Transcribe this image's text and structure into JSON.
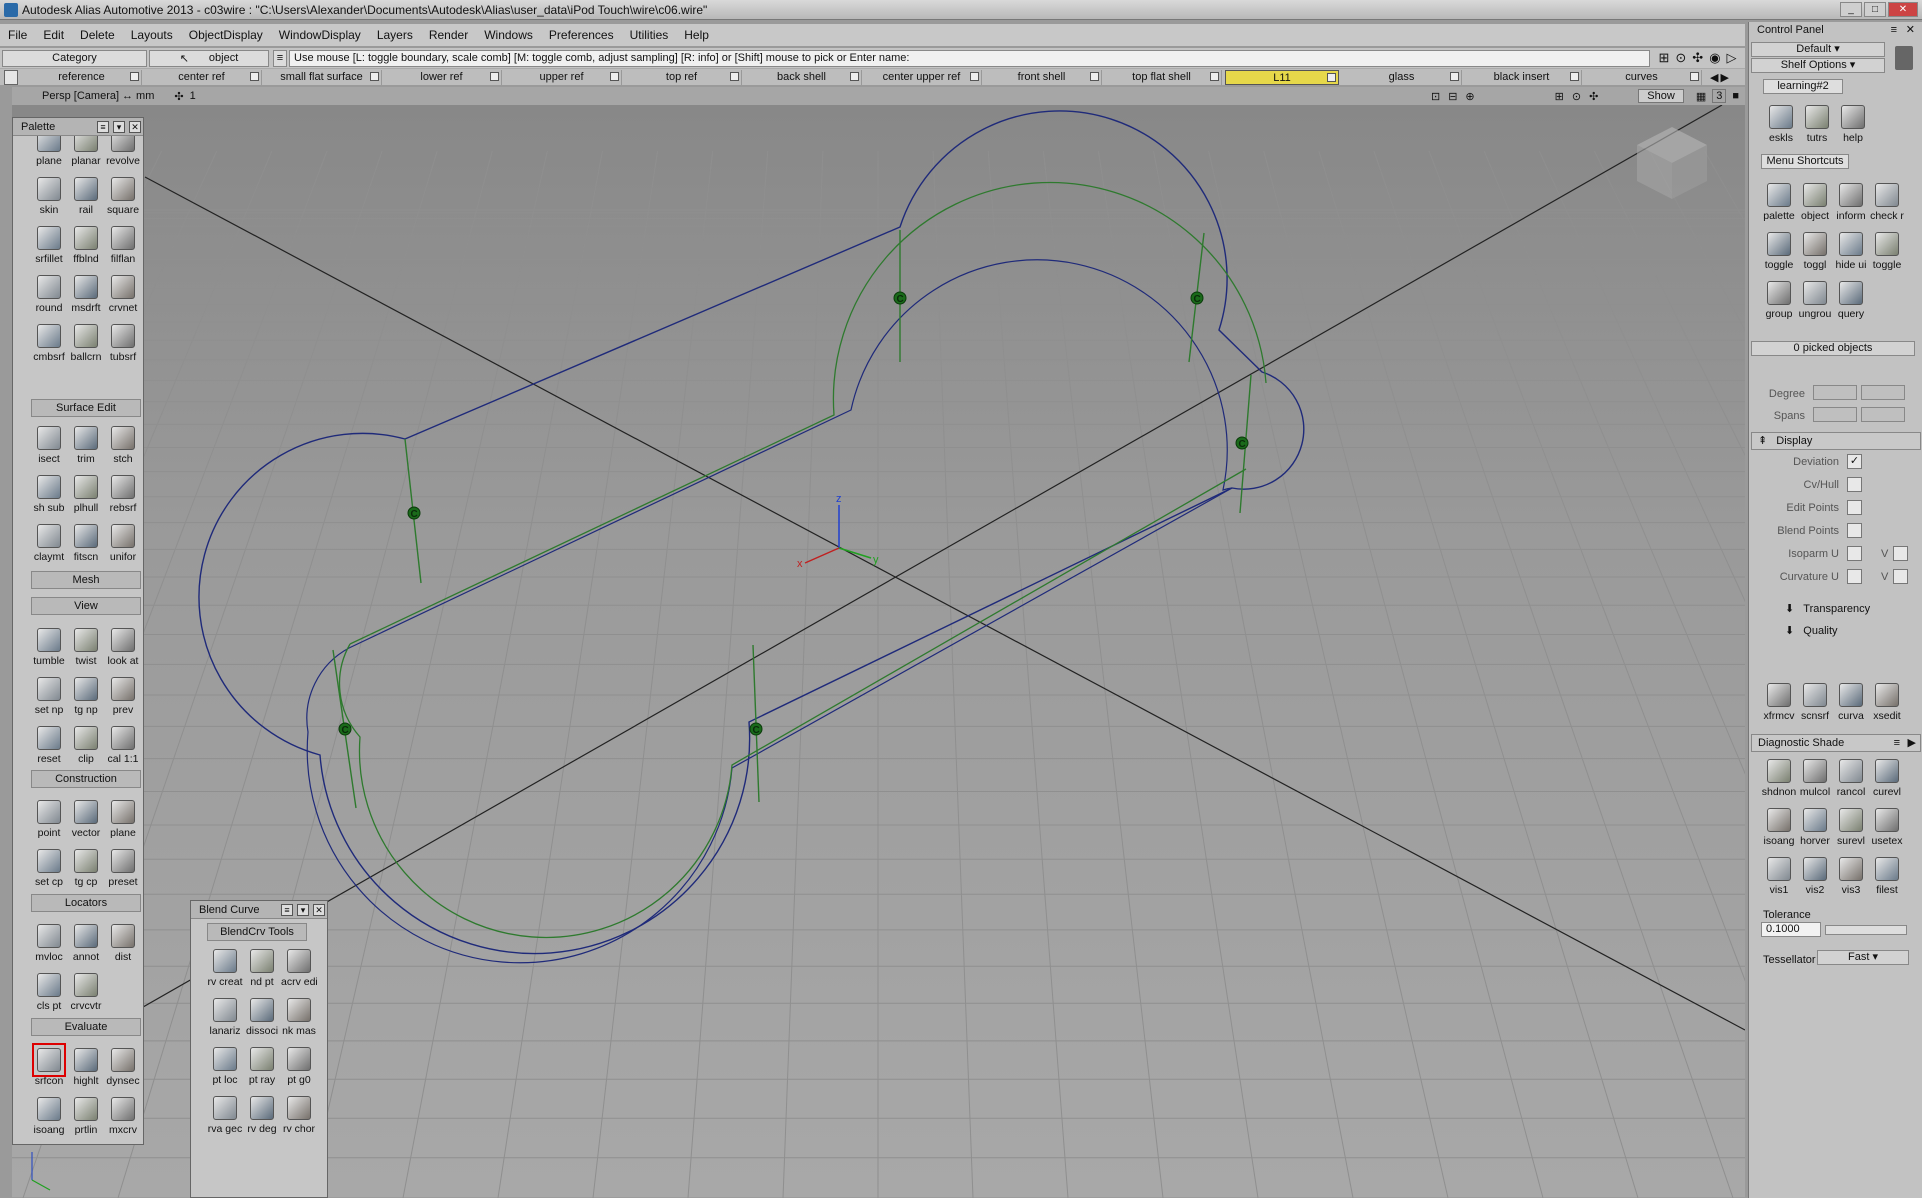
{
  "window": {
    "title": "Autodesk Alias Automotive 2013 - c03wire : \"C:\\Users\\Alexander\\Documents\\Autodesk\\Alias\\user_data\\iPod Touch\\wire\\c06.wire\""
  },
  "menu": [
    "File",
    "Edit",
    "Delete",
    "Layouts",
    "ObjectDisplay",
    "WindowDisplay",
    "Layers",
    "Render",
    "Windows",
    "Preferences",
    "Utilities",
    "Help"
  ],
  "cmdbar": {
    "category_label": "Category",
    "object_label": "object",
    "prompt": "Use mouse [L: toggle boundary, scale comb] [M: toggle comb, adjust sampling] [R: info] or [Shift] mouse to pick or Enter name:"
  },
  "shelves": [
    "reference",
    "center ref",
    "small flat surface",
    "lower ref",
    "upper ref",
    "top ref",
    "back shell",
    "center upper ref",
    "front shell",
    "top flat shell",
    "L11",
    "glass",
    "black insert",
    "curves"
  ],
  "active_shelf": "L11",
  "viewport": {
    "label": "Persp [Camera]",
    "units": "mm",
    "layer": "1",
    "show_button": "Show",
    "view_num": "3",
    "axis_labels": {
      "x": "x",
      "y": "y",
      "z": "z"
    },
    "cv_label": "C"
  },
  "palette": {
    "title": "Palette",
    "rows1": [
      [
        "plane",
        "planar",
        "revolve"
      ],
      [
        "skin",
        "rail",
        "square"
      ],
      [
        "srfillet",
        "ffblnd",
        "filflan"
      ],
      [
        "round",
        "msdrft",
        "crvnet"
      ],
      [
        "cmbsrf",
        "ballcrn",
        "tubsrf"
      ]
    ],
    "surface_edit": "Surface Edit",
    "rows2": [
      [
        "isect",
        "trim",
        "stch"
      ],
      [
        "sh sub",
        "plhull",
        "rebsrf"
      ],
      [
        "claymt",
        "fitscn",
        "unifor"
      ]
    ],
    "mesh": "Mesh",
    "view": "View",
    "rows3": [
      [
        "tumble",
        "twist",
        "look at"
      ],
      [
        "set np",
        "tg np",
        "prev"
      ],
      [
        "reset",
        "clip",
        "cal 1:1"
      ]
    ],
    "construction": "Construction",
    "rows4": [
      [
        "point",
        "vector",
        "plane"
      ],
      [
        "set cp",
        "tg cp",
        "preset"
      ]
    ],
    "locators": "Locators",
    "rows5": [
      [
        "mvloc",
        "annot",
        "dist"
      ],
      [
        "cls pt",
        "crvcvtr",
        ""
      ]
    ],
    "evaluate": "Evaluate",
    "rows6": [
      [
        "srfcon",
        "highlt",
        "dynsec"
      ],
      [
        "isoang",
        "prtlin",
        "mxcrv"
      ]
    ]
  },
  "blend": {
    "title": "Blend Curve",
    "tab": "BlendCrv Tools",
    "rows": [
      [
        "rv creat",
        "nd pt",
        "acrv edit"
      ],
      [
        "lanariz",
        "dissoci",
        "nk mas"
      ],
      [
        "pt loc",
        "pt ray",
        "pt g0"
      ],
      [
        "rva gec",
        "rv deg",
        "rv chor"
      ]
    ]
  },
  "control_panel": {
    "title": "Control Panel",
    "default_sel": "Default",
    "shelf_options": "Shelf Options",
    "tab": "learning#2",
    "tools1": [
      "eskls",
      "tutrs",
      "help"
    ],
    "menu_shortcuts": "Menu Shortcuts",
    "tools2": [
      [
        "palette",
        "object",
        "inform",
        "check r"
      ],
      [
        "toggle",
        "toggl",
        "hide ui",
        "toggle"
      ],
      [
        "group",
        "ungrou",
        "query",
        ""
      ]
    ],
    "picked": "0 picked objects",
    "degree": "Degree",
    "spans": "Spans",
    "display": "Display",
    "display_items": [
      "Deviation",
      "Cv/Hull",
      "Edit Points",
      "Blend Points",
      "Isoparm U",
      "Curvature U"
    ],
    "v_label": "V",
    "transparency": "Transparency",
    "quality": "Quality",
    "tools3": [
      "xfrmcv",
      "scnsrf",
      "curva",
      "xsedit"
    ],
    "diag_title": "Diagnostic Shade",
    "diag_rows": [
      [
        "shdnon",
        "mulcol",
        "rancol",
        "curevl"
      ],
      [
        "isoang",
        "horver",
        "surevl",
        "usetex"
      ],
      [
        "vis1",
        "vis2",
        "vis3",
        "filest"
      ]
    ],
    "tolerance_label": "Tolerance",
    "tolerance_value": "0.1000",
    "tessellator_label": "Tessellator",
    "tessellator_value": "Fast"
  },
  "colors": {
    "curve_blue": "#1f2a7a",
    "line_green": "#2e7a2e",
    "active_shelf": "#e6d84a"
  }
}
